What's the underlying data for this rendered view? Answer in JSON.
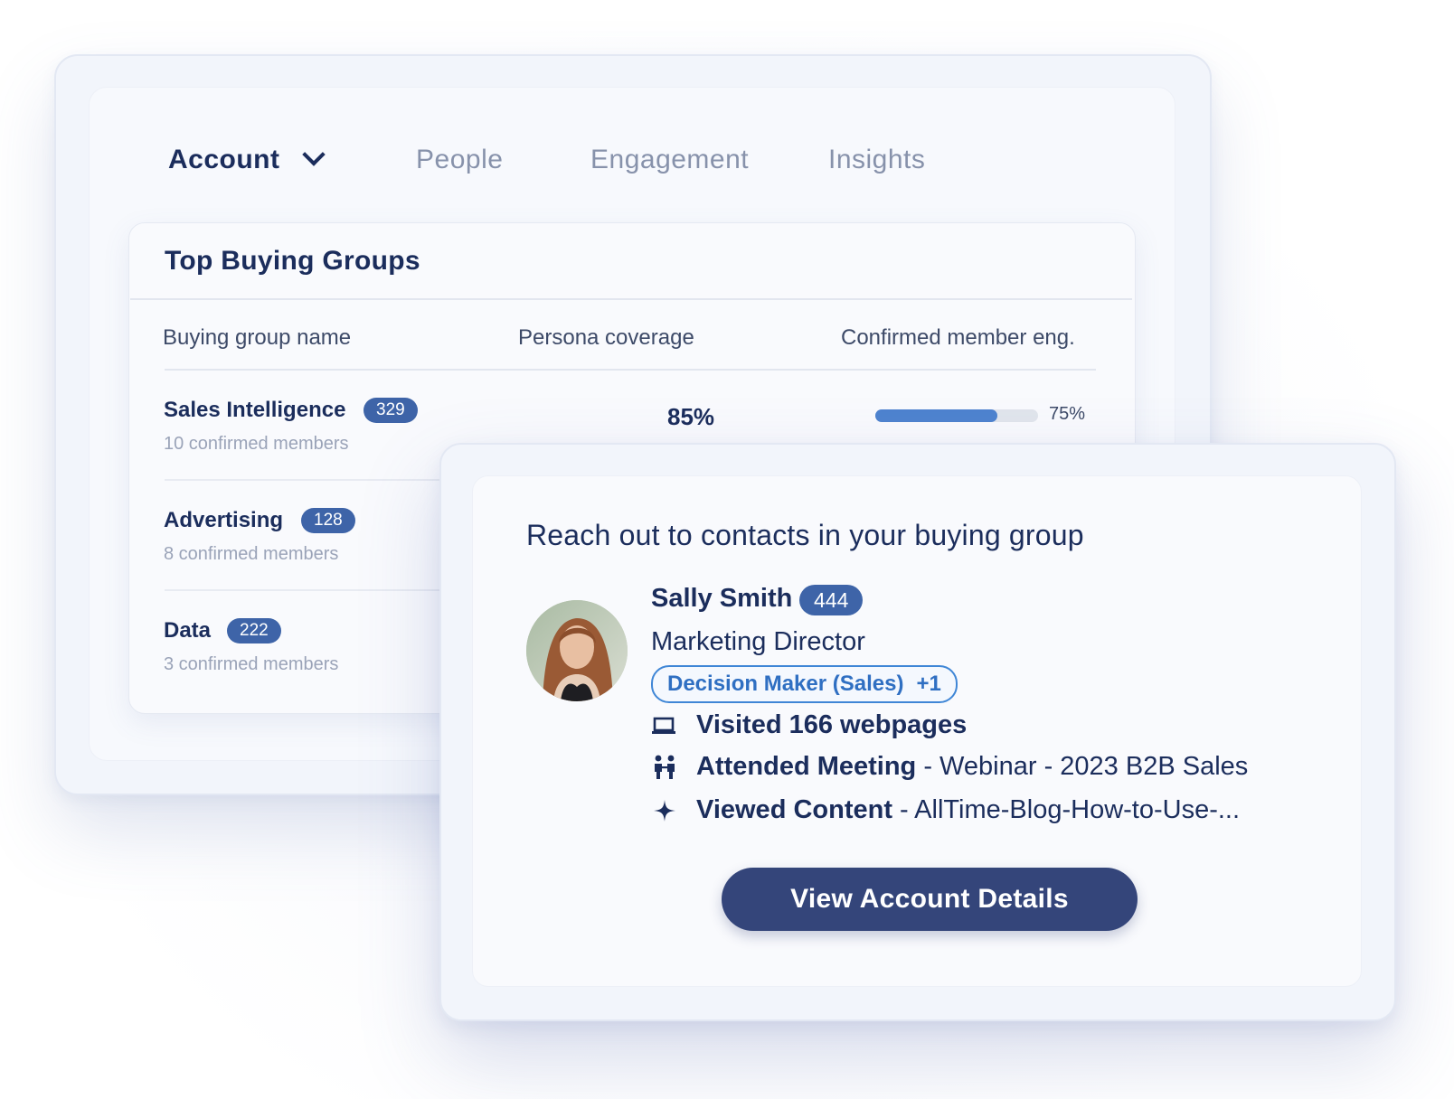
{
  "tabs": [
    {
      "label": "Account",
      "active": true
    },
    {
      "label": "People",
      "active": false
    },
    {
      "label": "Engagement",
      "active": false
    },
    {
      "label": "Insights",
      "active": false
    }
  ],
  "buying_groups": {
    "title": "Top Buying Groups",
    "columns": [
      "Buying group name",
      "Persona coverage",
      "Confirmed member eng."
    ],
    "rows": [
      {
        "name": "Sales Intelligence",
        "count": "329",
        "members": "10 confirmed members",
        "coverage": "85%",
        "engagement_label": "75%",
        "engagement_fraction": 0.75
      },
      {
        "name": "Advertising",
        "count": "128",
        "members": "8 confirmed members"
      },
      {
        "name": "Data",
        "count": "222",
        "members": "3 confirmed members"
      }
    ]
  },
  "outreach": {
    "title": "Reach out to contacts in your buying group",
    "contact": {
      "name": "Sally Smith",
      "score": "444",
      "role": "Marketing Director",
      "persona": "Decision Maker (Sales)",
      "persona_extra": "+1"
    },
    "activities": [
      {
        "icon": "laptop-icon",
        "action": "Visited 166 webpages",
        "detail": ""
      },
      {
        "icon": "people-icon",
        "action": "Attended Meeting",
        "detail": " - Webinar - 2023 B2B Sales"
      },
      {
        "icon": "sparkle-icon",
        "action": "Viewed Content",
        "detail": " - AllTime-Blog-How-to-Use-..."
      }
    ],
    "cta": "View Account Details"
  },
  "colors": {
    "primary_dark": "#1b2d5c",
    "badge": "#3e64a8",
    "progress": "#4e83cf",
    "tag_border": "#3f86d6",
    "button": "#34457a"
  }
}
